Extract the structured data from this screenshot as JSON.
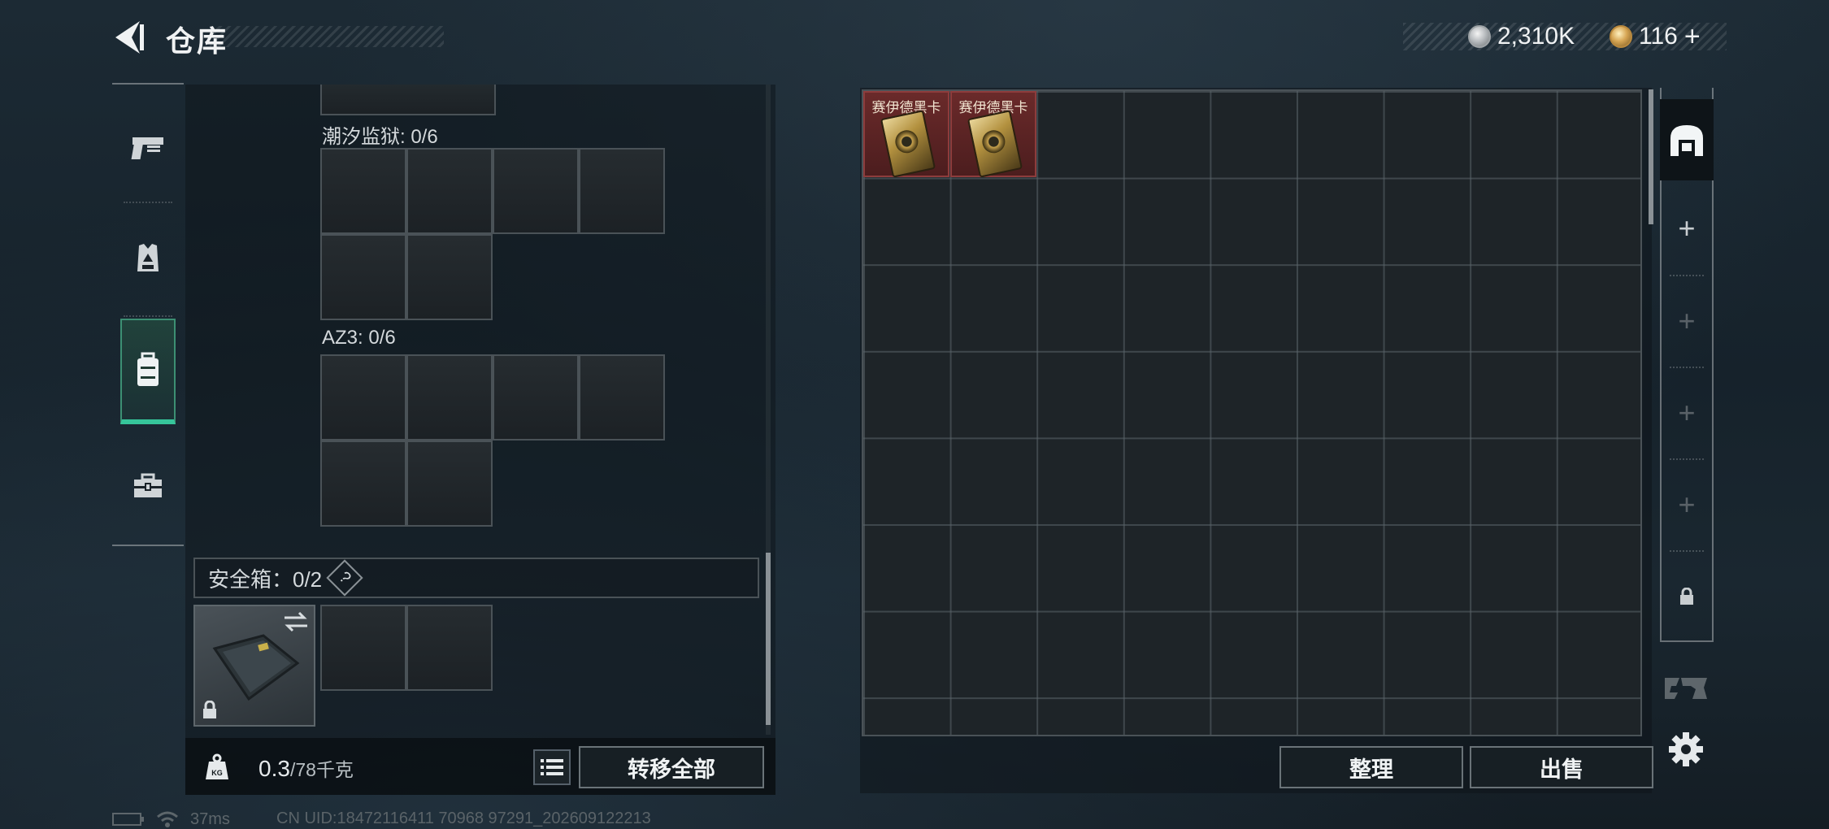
{
  "header": {
    "title": "仓库",
    "currencies": [
      {
        "icon": "silver-coin-icon",
        "value": "2,310K"
      },
      {
        "icon": "gold-coin-icon",
        "value": "116"
      }
    ],
    "add_symbol": "+"
  },
  "sidebar": {
    "items": [
      {
        "name": "weapon",
        "icon": "pistol-icon",
        "active": false
      },
      {
        "name": "armor",
        "icon": "vest-icon",
        "active": false
      },
      {
        "name": "backpack",
        "icon": "backpack-icon",
        "active": true
      },
      {
        "name": "case",
        "icon": "briefcase-icon",
        "active": false
      }
    ]
  },
  "containers": [
    {
      "label": "潮汐监狱: 0/6"
    },
    {
      "label": "AZ3: 0/6"
    }
  ],
  "safebox": {
    "label": "安全箱：0/2",
    "help": "?"
  },
  "bottom_bar": {
    "weight_icon_label": "KG",
    "weight_current": "0.3",
    "weight_max": "/78千克",
    "transfer_all": "转移全部"
  },
  "stash": {
    "items": [
      {
        "name": "赛伊德黑卡"
      },
      {
        "name": "赛伊德黑卡"
      }
    ],
    "sort_button": "整理",
    "sell_button": "出售"
  },
  "stash_tabs": [
    {
      "type": "main",
      "icon": "stash-icon"
    },
    {
      "type": "add",
      "symbol": "+"
    },
    {
      "type": "add",
      "symbol": "+"
    },
    {
      "type": "add",
      "symbol": "+"
    },
    {
      "type": "add",
      "symbol": "+"
    },
    {
      "type": "locked",
      "icon": "lock-icon"
    }
  ],
  "status": {
    "ping": "37ms",
    "uid": "CN UID:18472116411 70968 97291_202609122213"
  },
  "colors": {
    "accent_green": "#36c59a",
    "item_red": "#6a2a2a",
    "gold": "#d7a654"
  }
}
